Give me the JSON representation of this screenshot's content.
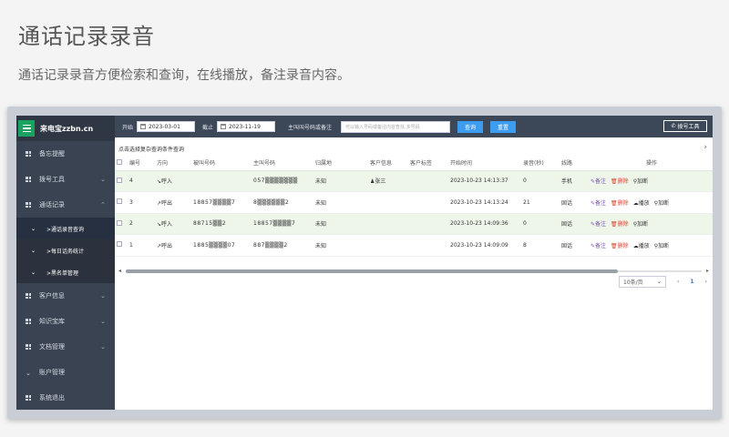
{
  "header": {
    "title": "通话记录录音",
    "subtitle": "通话记录录音方便检索和查询，在线播放，备注录音内容。"
  },
  "sidebar": {
    "brand": "来电宝zzbn.cn",
    "items": [
      {
        "label": "备忘提醒"
      },
      {
        "label": "拨号工具"
      },
      {
        "label": "通话记录"
      },
      {
        "label": "客户信息"
      },
      {
        "label": "知识宝库"
      },
      {
        "label": "文档管理"
      },
      {
        "label": "账户管理"
      },
      {
        "label": "系统退出"
      }
    ],
    "subitems": [
      {
        "label": ">通话录音查询"
      },
      {
        "label": ">每日话务统计"
      },
      {
        "label": ">黑名单管理"
      }
    ]
  },
  "filter": {
    "start_label": "开始",
    "start_date": "2023-03-01",
    "end_label": "截止",
    "end_date": "2023-11-19",
    "search_label": "主叫叫号码或备注",
    "search_placeholder": "可以输入号码或备注内容查找,多号码",
    "query_label": "查询",
    "reset_label": "重置",
    "dial_label": "拨号工具"
  },
  "hint": "点击选择复杂查询条件查询",
  "table": {
    "columns": [
      "编号",
      "方向",
      "被叫号码",
      "主叫号码",
      "归属地",
      "客户信息",
      "客户标签",
      "开始时间",
      "录音(秒)",
      "线路",
      "操作"
    ],
    "rows": [
      {
        "id": "4",
        "dir": "↘呼入",
        "callee": "",
        "caller": "057▒▒▒▒▒▒▒",
        "loc": "未知",
        "cust": "张三",
        "tag": "",
        "time": "2023-10-23 14:13:37",
        "sec": "0",
        "line": "手机",
        "acts": [
          "备注",
          "删除",
          "加断"
        ]
      },
      {
        "id": "3",
        "dir": "↗呼出",
        "callee": "18857▒▒▒▒7",
        "caller": "8▒▒▒▒▒▒2",
        "loc": "未知",
        "cust": "",
        "tag": "",
        "time": "2023-10-23 14:13:24",
        "sec": "21",
        "line": "固话",
        "acts": [
          "备注",
          "删除",
          "播放",
          "加断"
        ]
      },
      {
        "id": "2",
        "dir": "↘呼入",
        "callee": "88715▒▒2",
        "caller": "18857▒▒▒▒7",
        "loc": "未知",
        "cust": "",
        "tag": "",
        "time": "2023-10-23 14:09:36",
        "sec": "0",
        "line": "固话",
        "acts": [
          "备注",
          "删除",
          "加断"
        ]
      },
      {
        "id": "1",
        "dir": "↗呼出",
        "callee": "1885▒▒▒▒07",
        "caller": "887▒▒▒▒2",
        "loc": "未知",
        "cust": "",
        "tag": "",
        "time": "2023-10-23 14:09:09",
        "sec": "8",
        "line": "固话",
        "acts": [
          "备注",
          "删除",
          "播放",
          "加断"
        ]
      }
    ]
  },
  "pager": {
    "size": "10条/页",
    "prev": "‹",
    "page": "1",
    "next": "›"
  }
}
